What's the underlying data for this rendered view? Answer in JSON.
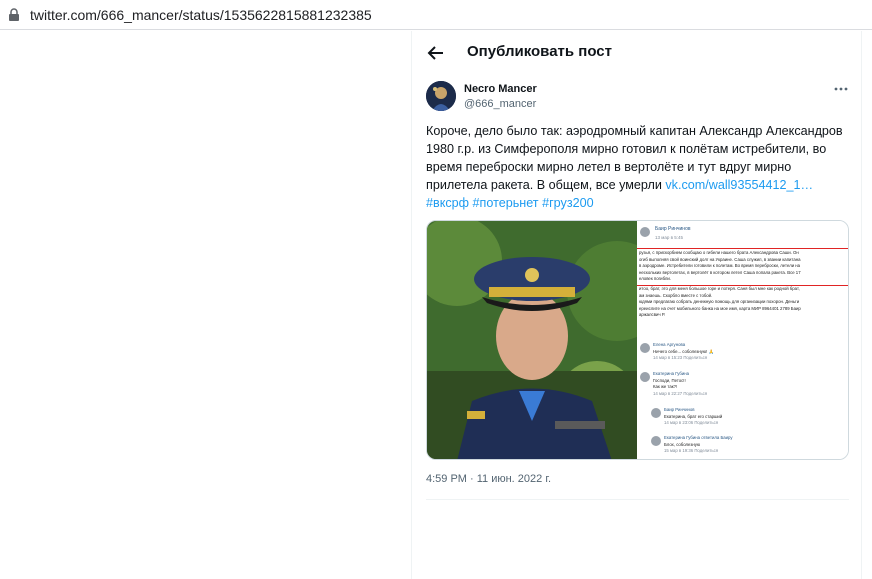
{
  "browser": {
    "url": "twitter.com/666_mancer/status/1535622815881232385"
  },
  "header": {
    "title": "Опубликовать пост"
  },
  "tweet": {
    "author_name": "Necro Mancer",
    "author_handle": "@666_mancer",
    "body": "Короче, дело было так: аэродромный капитан Александр Александров 1980 г.р. из Симферополя мирно готовил к полётам истребители, во время переброски мирно летел в вертолёте и тут вдруг мирно прилетела ракета. В общем, все умерли ",
    "link": "vk.com/wall93554412_1…",
    "hashtags": [
      "#вксрф",
      "#потерьнет",
      "#груз200"
    ],
    "timestamp": "4:59 PM · 11 июн. 2022 г."
  },
  "embedded_screenshot": {
    "poster_name": "Баир Ринчинов",
    "poster_date": "13 мар в 5:45",
    "post_lines": [
      "рузья, с прискорбием сообщаю о гибели нашего брата Александрова Саши. Он",
      "огиб выполняя свой воинский долг на Украине. Саша служил, в звании капитана",
      "в аэродроме. Истребители готовили к полетам. Во время переброски, летели на",
      "нескольких вертолетах, в вертолёт в котором летел Саша попала ракета. Все 17",
      "еловек погибли.",
      "итоо, брат, это для меня большое горе и потеря. Саня был мне как родной брат,",
      "ам знаешь. Скорбло вместе с тобой.",
      "юдями предлагаю собрать денежную помощь для организации похорон. Деньги",
      "ереислите на счет мобильного банка на мое имя, карта МИР 8964401 2789 Баир",
      "аржалсвич Р."
    ],
    "comments": [
      {
        "author": "Елена Аргунова",
        "text": "Ничего себе... соболезную! 🙏",
        "meta": "14 мар в 15:23   Поделиться"
      },
      {
        "author": "Екатерина Губина",
        "text": "Господи, Петос!!",
        "text2": "Как же так?!",
        "meta": "14 мар в 22:27   Поделиться"
      },
      {
        "author": "Баир Ринчинов",
        "text": "Екатерина, брат его старший",
        "meta": "14 мар в 23:06   Поделиться"
      },
      {
        "author": "Екатерина Губина ответила Баиру",
        "text": "Блох, соболезную",
        "meta": "15 мар в 19:36   Поделиться"
      }
    ]
  },
  "colors": {
    "accent": "#1d9bf0",
    "text": "#0f1419",
    "secondary": "#536471",
    "highlight_line": "#e02424"
  },
  "icons": {
    "back": "arrow-left-icon",
    "more": "more-horizontal-icon",
    "lock": "lock-icon"
  }
}
